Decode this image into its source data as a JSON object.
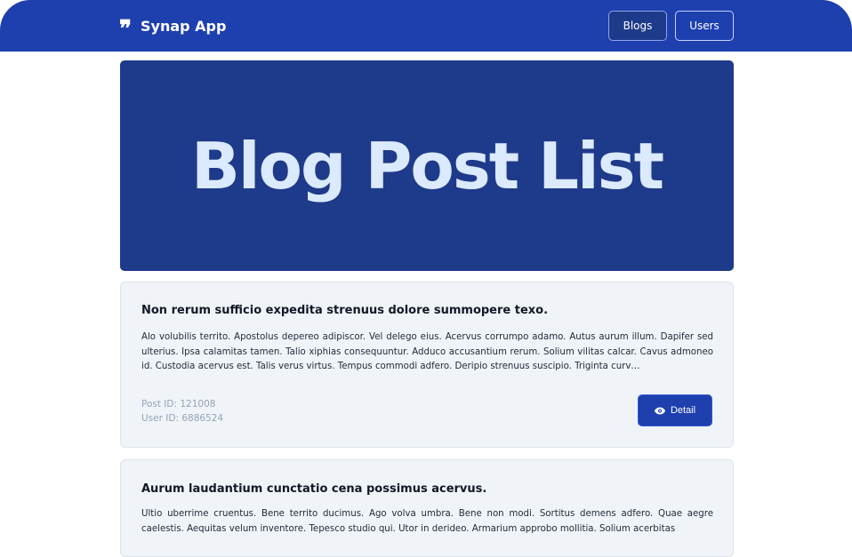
{
  "navbar": {
    "brand": "Synap App",
    "brand_icon": "quote-icon",
    "links": [
      {
        "label": "Blogs",
        "active": true
      },
      {
        "label": "Users",
        "active": false
      }
    ],
    "color": "#1e40af"
  },
  "hero": {
    "title": "Blog Post List",
    "background": "#1e3a8a",
    "text_color": "#dbeafe"
  },
  "posts": [
    {
      "title": "Non rerum sufficio expedita strenuus dolore summopere texo.",
      "body": "Alo volubilis territo. Apostolus depereo adipiscor. Vel delego eius. Acervus corrumpo adamo. Autus aurum illum. Dapifer sed ulterius. Ipsa calamitas tamen. Talio xiphias consequuntur. Adduco accusantium rerum. Solium vilitas calcar. Cavus admoneo id. Custodia acervus est. Talis verus virtus. Tempus commodi adfero. Deripio strenuus suscipio. Triginta curv…",
      "post_id": "Post ID: 121008",
      "user_id": "User ID: 6886524",
      "button_label": "Detail",
      "button_icon": "eye-icon"
    },
    {
      "title": "Aurum laudantium cunctatio cena possimus acervus.",
      "body": "Ultio uberrime cruentus. Bene territo ducimus. Ago volva umbra. Bene non modi. Sortitus demens adfero. Quae aegre caelestis. Aequitas velum inventore. Tepesco studio qui. Utor in derideo. Armarium approbo mollitia. Solium acerbitas",
      "post_id": "",
      "user_id": "",
      "button_label": "",
      "button_icon": ""
    }
  ]
}
